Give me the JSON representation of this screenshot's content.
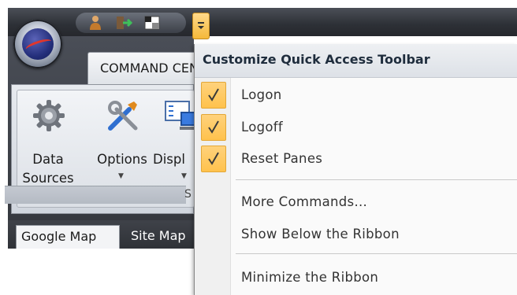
{
  "app": {
    "orb_icon": "app-orb-logo",
    "qat_icons": [
      "logon-icon",
      "logoff-icon",
      "reset-panes-icon"
    ]
  },
  "ribbon": {
    "active_tab": "COMMAND CENTER",
    "group_label": "S",
    "buttons": [
      {
        "label": "Data\nSources",
        "icon": "gear-icon",
        "has_dropdown": false
      },
      {
        "label": "Options",
        "icon": "tools-icon",
        "has_dropdown": true
      },
      {
        "label": "Displ",
        "icon": "display-icon",
        "has_dropdown": true
      }
    ]
  },
  "doc_tabs": [
    {
      "label": "Google Map"
    },
    {
      "label": "Site Map"
    }
  ],
  "menu": {
    "title": "Customize Quick Access Toolbar",
    "items": [
      {
        "label": "Logon",
        "checked": true
      },
      {
        "label": "Logoff",
        "checked": true
      },
      {
        "label": "Reset Panes",
        "checked": true
      },
      {
        "label": "More Commands...",
        "checked": false
      },
      {
        "label": "Show Below the Ribbon",
        "checked": false
      },
      {
        "label": "Minimize the Ribbon",
        "checked": false
      }
    ]
  },
  "colors": {
    "check_highlight": "#ffc24d",
    "titlebar_dark": "#2d3036",
    "ribbon_light": "#dce0e6"
  }
}
